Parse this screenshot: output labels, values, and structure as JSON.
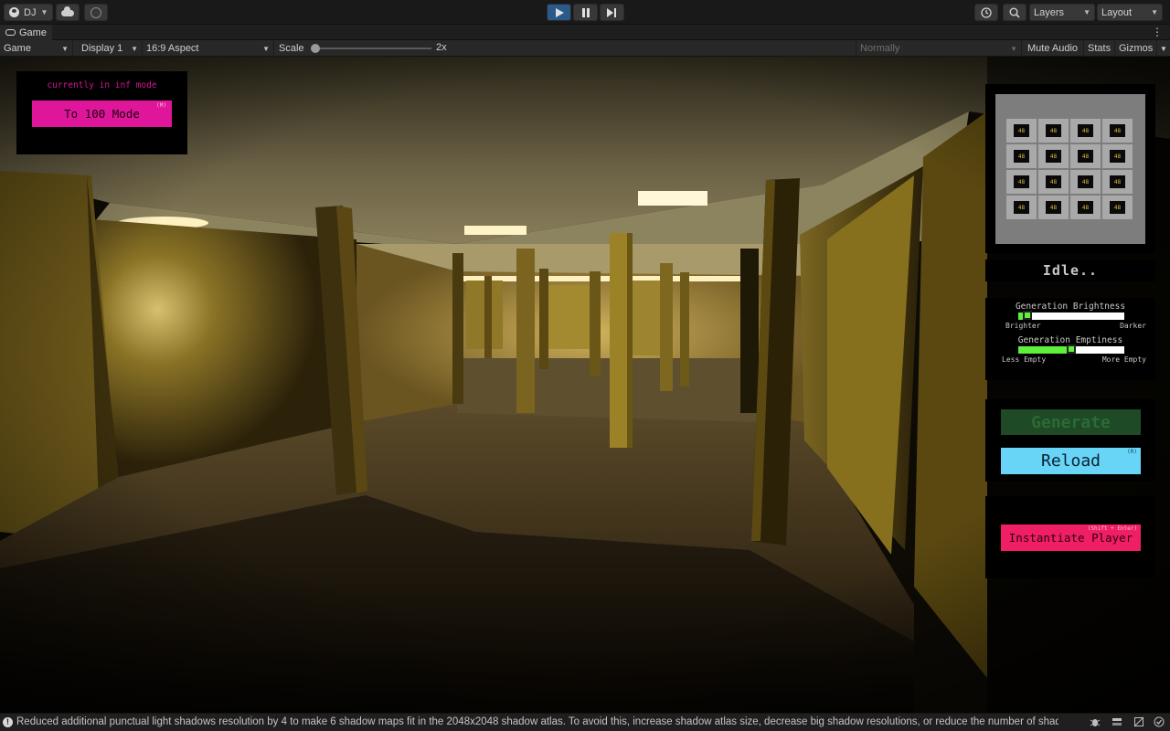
{
  "toolbar": {
    "account_label": "DJ",
    "layers_label": "Layers",
    "layout_label": "Layout",
    "icons": [
      "account-icon",
      "cloud-icon",
      "collab-icon",
      "play-icon",
      "pause-icon",
      "step-icon",
      "history-icon",
      "search-icon"
    ]
  },
  "tab": {
    "title": "Game"
  },
  "control_bar": {
    "game_select": "Game",
    "display_select": "Display 1",
    "aspect_select": "16:9 Aspect",
    "scale_label": "Scale",
    "scale_value": "2x",
    "scale_fraction": 0.0,
    "play_mode_select": "Normally",
    "mute_audio": "Mute Audio",
    "stats": "Stats",
    "gizmos": "Gizmos"
  },
  "game_ui": {
    "mode_panel": {
      "status_text": "currently in inf mode",
      "button_label": "To 100 Mode",
      "button_hint": "(M)"
    },
    "minimap": {
      "cell_label": "48",
      "rows": 4,
      "cols": 4
    },
    "state_text": "Idle..",
    "sliders": [
      {
        "title": "Generation Brightness",
        "left_label": "Brighter",
        "right_label": "Darker",
        "value": 0.05
      },
      {
        "title": "Generation Emptiness",
        "left_label": "Less Empty",
        "right_label": "More Empty",
        "value": 0.5
      }
    ],
    "generate_label": "Generate",
    "reload_label": "Reload",
    "reload_hint": "(R)",
    "instantiate_label": "Instantiate Player",
    "instantiate_hint": "(Shift + Enter)"
  },
  "colors": {
    "magenta": "#e0169a",
    "cyan": "#68d4f6",
    "generate_green": "#1e4a26",
    "pink": "#f01e64",
    "slider_green": "#5ef03c"
  },
  "status_bar": {
    "message": "Reduced additional punctual light shadows resolution by 4 to make 6 shadow maps fit in the 2048x2048 shadow atlas. To avoid this, increase shadow atlas size, decrease big shadow resolutions, or reduce the number of shadow m",
    "icons": [
      "warning-icon",
      "bug-icon",
      "layers-icon",
      "debug-icon",
      "check-icon"
    ]
  }
}
